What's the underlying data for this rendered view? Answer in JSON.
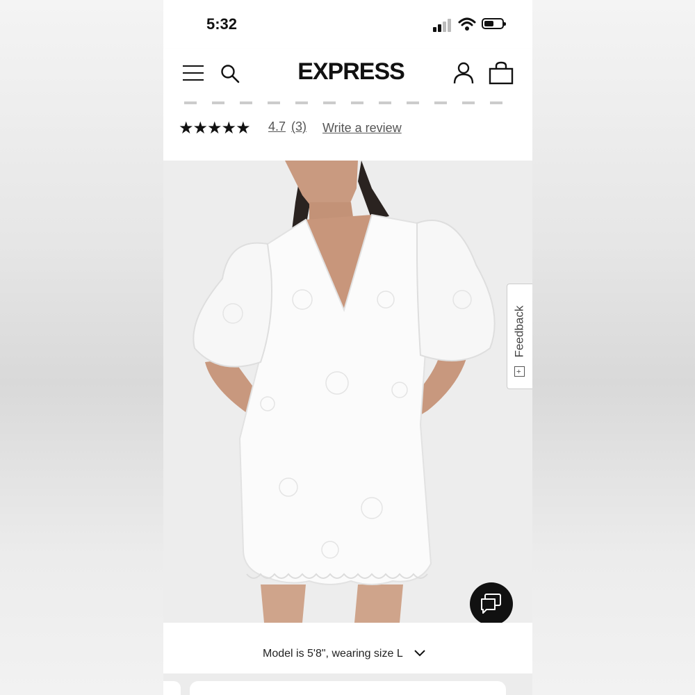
{
  "status_bar": {
    "time": "5:32"
  },
  "header": {
    "logo": "EXPRESS"
  },
  "rating": {
    "stars": "★★★★★",
    "value": "4.7",
    "count": "(3)",
    "write_review": "Write a review"
  },
  "feedback": {
    "label": "Feedback",
    "plus": "+"
  },
  "model_info": {
    "text": "Model is 5'8\", wearing size L"
  },
  "icons": [
    "menu-icon",
    "search-icon",
    "account-icon",
    "bag-icon",
    "chat-icon",
    "chevron-down-icon",
    "signal-icon",
    "wifi-icon",
    "battery-icon"
  ]
}
